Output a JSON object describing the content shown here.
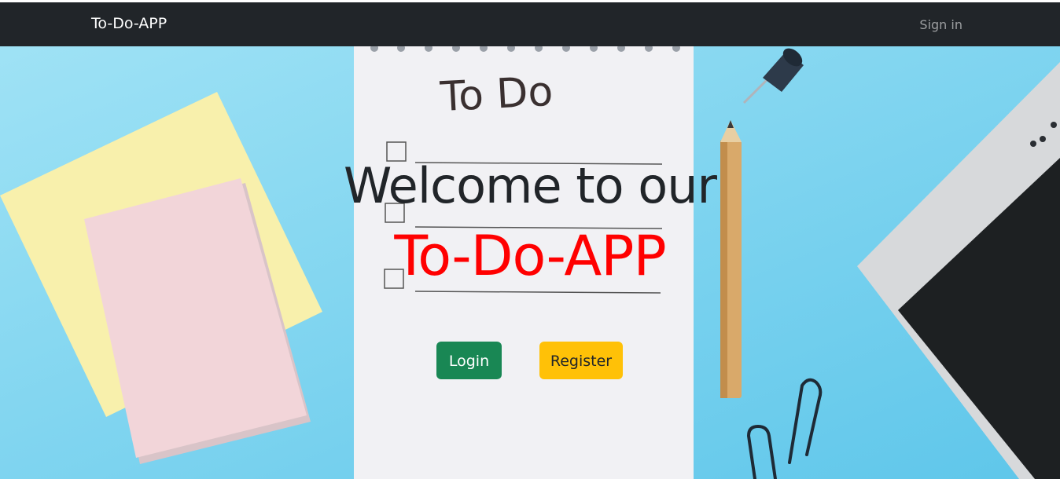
{
  "navbar": {
    "brand": "To-Do-APP",
    "sign_in": "Sign in"
  },
  "hero": {
    "heading_line1": "Welcome to our",
    "heading_line2": "To-Do-APP",
    "notepad_text": "To Do",
    "login_label": "Login",
    "register_label": "Register"
  },
  "colors": {
    "navbar_bg": "#212529",
    "background": "#7fd3ef",
    "accent_title": "#ff0000",
    "login_button": "#198754",
    "register_button": "#ffc107"
  },
  "icons": [
    "pushpin-icon",
    "pencil-icon",
    "paperclip-icon"
  ]
}
